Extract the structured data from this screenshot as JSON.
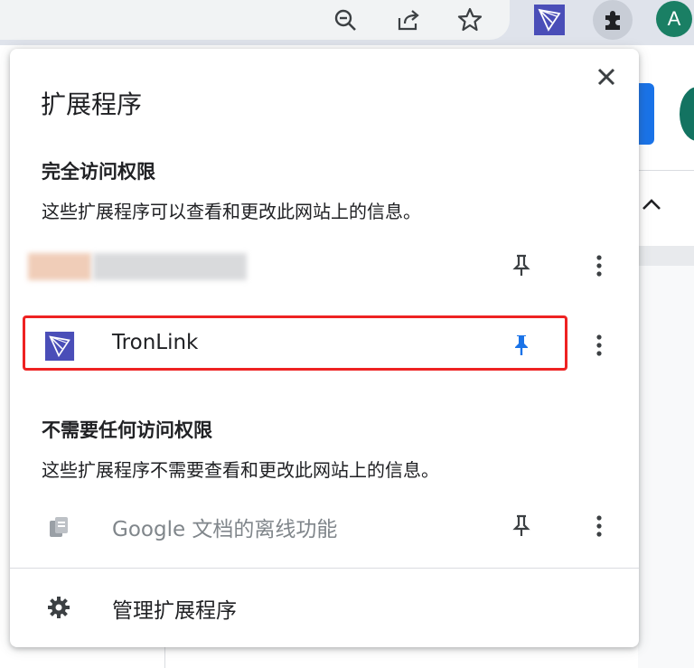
{
  "toolbar": {
    "icons": [
      "zoom-out-icon",
      "share-icon",
      "bookmark-star-icon",
      "tronlink-icon",
      "extensions-puzzle-icon"
    ],
    "avatar_letter": "A"
  },
  "popup": {
    "title": "扩展程序",
    "close_icon": "close-icon",
    "full_access": {
      "heading": "完全访问权限",
      "description": "这些扩展程序可以查看和更改此网站上的信息。",
      "items": [
        {
          "name": "",
          "blurred": true,
          "pinned": false
        },
        {
          "name": "TronLink",
          "pinned": true,
          "highlighted": true
        }
      ]
    },
    "no_access": {
      "heading": "不需要任何访问权限",
      "description": "这些扩展程序不需要查看和更改此网站上的信息。",
      "items": [
        {
          "name": "Google 文档的离线功能",
          "pinned": false,
          "dimmed": true
        }
      ]
    },
    "manage_label": "管理扩展程序"
  },
  "colors": {
    "accent": "#1a73e8",
    "highlight_border": "#ee2222",
    "tronlink_icon": "#4a4eb8",
    "dimmed_text": "#80868b"
  }
}
